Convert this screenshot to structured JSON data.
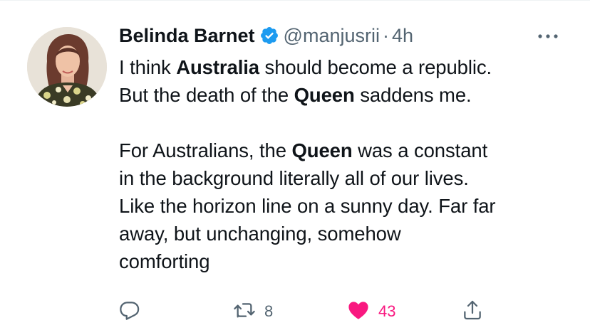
{
  "tweet": {
    "display_name": "Belinda Barnet",
    "handle": "@manjusrii",
    "separator": "·",
    "time": "4h",
    "body": {
      "l1_a": "I think ",
      "l1_b": "Australia",
      "l1_c": " should become a republic.",
      "l2_a": "But the death of the ",
      "l2_b": "Queen",
      "l2_c": " saddens me.",
      "l3_a": "For Australians, the ",
      "l3_b": "Queen",
      "l3_c": " was a constant",
      "l4": "in the background literally all of our lives.",
      "l5": "Like the horizon line on a sunny day. Far far",
      "l6": "away, but unchanging, somehow",
      "l7": "comforting"
    },
    "actions": {
      "retweet_count": "8",
      "like_count": "43"
    }
  },
  "colors": {
    "text": "#0f1419",
    "muted": "#536471",
    "verified": "#1d9bf0",
    "like": "#f91880"
  },
  "icons": [
    "verified-badge-icon",
    "more-icon",
    "reply-icon",
    "retweet-icon",
    "like-icon",
    "share-icon"
  ]
}
